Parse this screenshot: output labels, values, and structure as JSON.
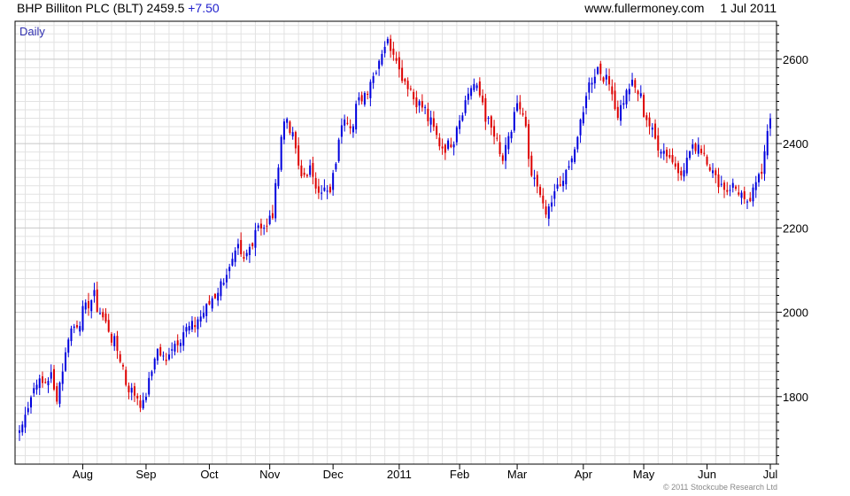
{
  "header": {
    "title": "BHP Billiton PLC (BLT)",
    "last": "2459.5",
    "change": "+7.50",
    "source": "www.fullermoney.com",
    "date": "1 Jul 2011"
  },
  "copyright": "© 2011 Stockcube Research Ltd",
  "colors": {
    "up": "#0000dd",
    "down": "#dd0000",
    "grid": "#e2e2e2",
    "frame": "#000000"
  },
  "chart_data": {
    "type": "candlestick",
    "period_label": "Daily",
    "y_ticks": [
      1800,
      2000,
      2200,
      2400,
      2600
    ],
    "ylim": [
      1640,
      2690
    ],
    "x_ticks": [
      "Aug",
      "Sep",
      "Oct",
      "Nov",
      "Dec",
      "2011",
      "Feb",
      "Mar",
      "Apr",
      "May",
      "Jun",
      "Jul"
    ],
    "grid": true,
    "y_axis_side": "right",
    "series": [
      {
        "anchors": [
          [
            "2010-07-01",
            1720
          ],
          [
            "2010-07-06",
            1780
          ],
          [
            "2010-07-09",
            1840
          ],
          [
            "2010-07-13",
            1830
          ],
          [
            "2010-07-16",
            1850
          ],
          [
            "2010-07-20",
            1800
          ],
          [
            "2010-07-23",
            1900
          ],
          [
            "2010-07-27",
            1960
          ],
          [
            "2010-07-30",
            1980
          ],
          [
            "2010-08-03",
            2010
          ],
          [
            "2010-08-06",
            2040
          ],
          [
            "2010-08-10",
            2000
          ],
          [
            "2010-08-13",
            1960
          ],
          [
            "2010-08-17",
            1930
          ],
          [
            "2010-08-20",
            1870
          ],
          [
            "2010-08-24",
            1820
          ],
          [
            "2010-08-27",
            1800
          ],
          [
            "2010-08-31",
            1780
          ],
          [
            "2010-09-03",
            1860
          ],
          [
            "2010-09-07",
            1910
          ],
          [
            "2010-09-10",
            1880
          ],
          [
            "2010-09-14",
            1920
          ],
          [
            "2010-09-17",
            1940
          ],
          [
            "2010-09-21",
            1960
          ],
          [
            "2010-09-24",
            1970
          ],
          [
            "2010-09-28",
            1990
          ],
          [
            "2010-10-01",
            2020
          ],
          [
            "2010-10-05",
            2040
          ],
          [
            "2010-10-08",
            2080
          ],
          [
            "2010-10-12",
            2100
          ],
          [
            "2010-10-15",
            2150
          ],
          [
            "2010-10-19",
            2120
          ],
          [
            "2010-10-22",
            2170
          ],
          [
            "2010-10-26",
            2210
          ],
          [
            "2010-10-29",
            2200
          ],
          [
            "2010-11-02",
            2230
          ],
          [
            "2010-11-05",
            2420
          ],
          [
            "2010-11-09",
            2460
          ],
          [
            "2010-11-12",
            2390
          ],
          [
            "2010-11-16",
            2320
          ],
          [
            "2010-11-19",
            2340
          ],
          [
            "2010-11-23",
            2300
          ],
          [
            "2010-11-26",
            2290
          ],
          [
            "2010-11-30",
            2280
          ],
          [
            "2010-12-03",
            2400
          ],
          [
            "2010-12-07",
            2470
          ],
          [
            "2010-12-10",
            2440
          ],
          [
            "2010-12-14",
            2500
          ],
          [
            "2010-12-17",
            2530
          ],
          [
            "2010-12-21",
            2560
          ],
          [
            "2010-12-24",
            2620
          ],
          [
            "2010-12-28",
            2640
          ],
          [
            "2010-12-31",
            2610
          ],
          [
            "2011-01-04",
            2560
          ],
          [
            "2011-01-07",
            2530
          ],
          [
            "2011-01-11",
            2500
          ],
          [
            "2011-01-14",
            2480
          ],
          [
            "2011-01-18",
            2450
          ],
          [
            "2011-01-21",
            2400
          ],
          [
            "2011-01-25",
            2390
          ],
          [
            "2011-01-28",
            2410
          ],
          [
            "2011-02-01",
            2460
          ],
          [
            "2011-02-04",
            2520
          ],
          [
            "2011-02-08",
            2540
          ],
          [
            "2011-02-11",
            2500
          ],
          [
            "2011-02-15",
            2450
          ],
          [
            "2011-02-18",
            2400
          ],
          [
            "2011-02-22",
            2360
          ],
          [
            "2011-02-25",
            2430
          ],
          [
            "2011-03-01",
            2490
          ],
          [
            "2011-03-04",
            2440
          ],
          [
            "2011-03-08",
            2320
          ],
          [
            "2011-03-11",
            2290
          ],
          [
            "2011-03-15",
            2230
          ],
          [
            "2011-03-18",
            2280
          ],
          [
            "2011-03-22",
            2300
          ],
          [
            "2011-03-25",
            2340
          ],
          [
            "2011-03-29",
            2390
          ],
          [
            "2011-04-01",
            2470
          ],
          [
            "2011-04-05",
            2540
          ],
          [
            "2011-04-08",
            2580
          ],
          [
            "2011-04-11",
            2570
          ],
          [
            "2011-04-15",
            2530
          ],
          [
            "2011-04-19",
            2470
          ],
          [
            "2011-04-22",
            2520
          ],
          [
            "2011-04-26",
            2540
          ],
          [
            "2011-04-29",
            2510
          ],
          [
            "2011-05-03",
            2460
          ],
          [
            "2011-05-06",
            2410
          ],
          [
            "2011-05-10",
            2390
          ],
          [
            "2011-05-13",
            2370
          ],
          [
            "2011-05-17",
            2350
          ],
          [
            "2011-05-20",
            2330
          ],
          [
            "2011-05-24",
            2380
          ],
          [
            "2011-05-27",
            2400
          ],
          [
            "2011-05-31",
            2380
          ],
          [
            "2011-06-03",
            2330
          ],
          [
            "2011-06-07",
            2310
          ],
          [
            "2011-06-10",
            2290
          ],
          [
            "2011-06-14",
            2300
          ],
          [
            "2011-06-17",
            2280
          ],
          [
            "2011-06-21",
            2250
          ],
          [
            "2011-06-24",
            2300
          ],
          [
            "2011-06-28",
            2340
          ],
          [
            "2011-06-30",
            2440
          ],
          [
            "2011-07-01",
            2459.5
          ]
        ]
      }
    ]
  }
}
